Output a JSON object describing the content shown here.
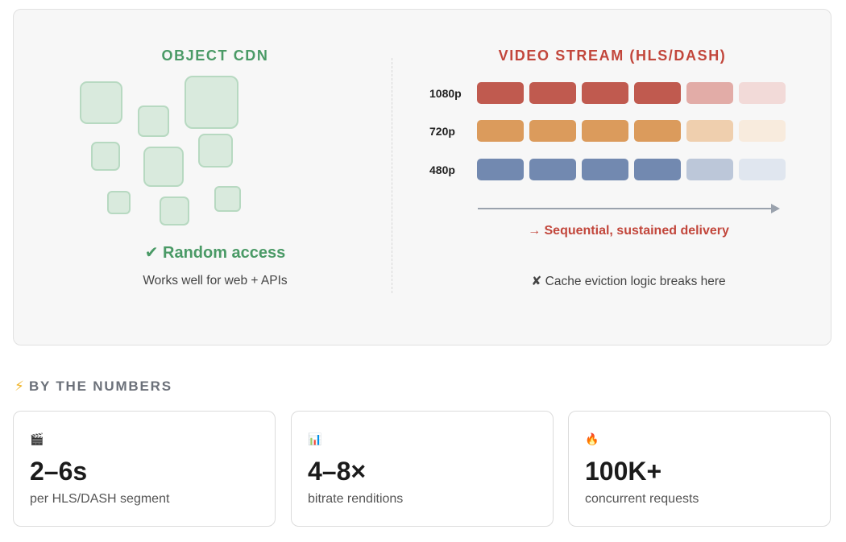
{
  "object_cdn": {
    "title": "OBJECT CDN",
    "check_label": "✔ Random access",
    "subtitle": "Works well for web + APIs"
  },
  "video_stream": {
    "title": "VIDEO STREAM (HLS/DASH)",
    "rows": [
      {
        "label": "1080p",
        "color": "#c05a4f",
        "faded_colors": [
          "#e2aca7",
          "#f2dad8"
        ]
      },
      {
        "label": "720p",
        "color": "#db9b5c",
        "faded_colors": [
          "#efcfae",
          "#f8ebdd"
        ]
      },
      {
        "label": "480p",
        "color": "#7289b0",
        "faded_colors": [
          "#bcc7d9",
          "#e0e6ef"
        ]
      }
    ],
    "sequence_label": "→ Sequential, sustained delivery",
    "subtitle": "✘ Cache eviction logic breaks here"
  },
  "numbers": {
    "heading_icon": "⚡",
    "heading": "BY THE NUMBERS",
    "cards": [
      {
        "icon": "🎬",
        "icon_name": "clapper-icon",
        "value": "2–6s",
        "label": "per HLS/DASH segment"
      },
      {
        "icon": "📊",
        "icon_name": "bar-chart-icon",
        "value": "4–8×",
        "label": "bitrate renditions"
      },
      {
        "icon": "🔥",
        "icon_name": "fire-icon",
        "value": "100K+",
        "label": "concurrent requests"
      }
    ]
  }
}
